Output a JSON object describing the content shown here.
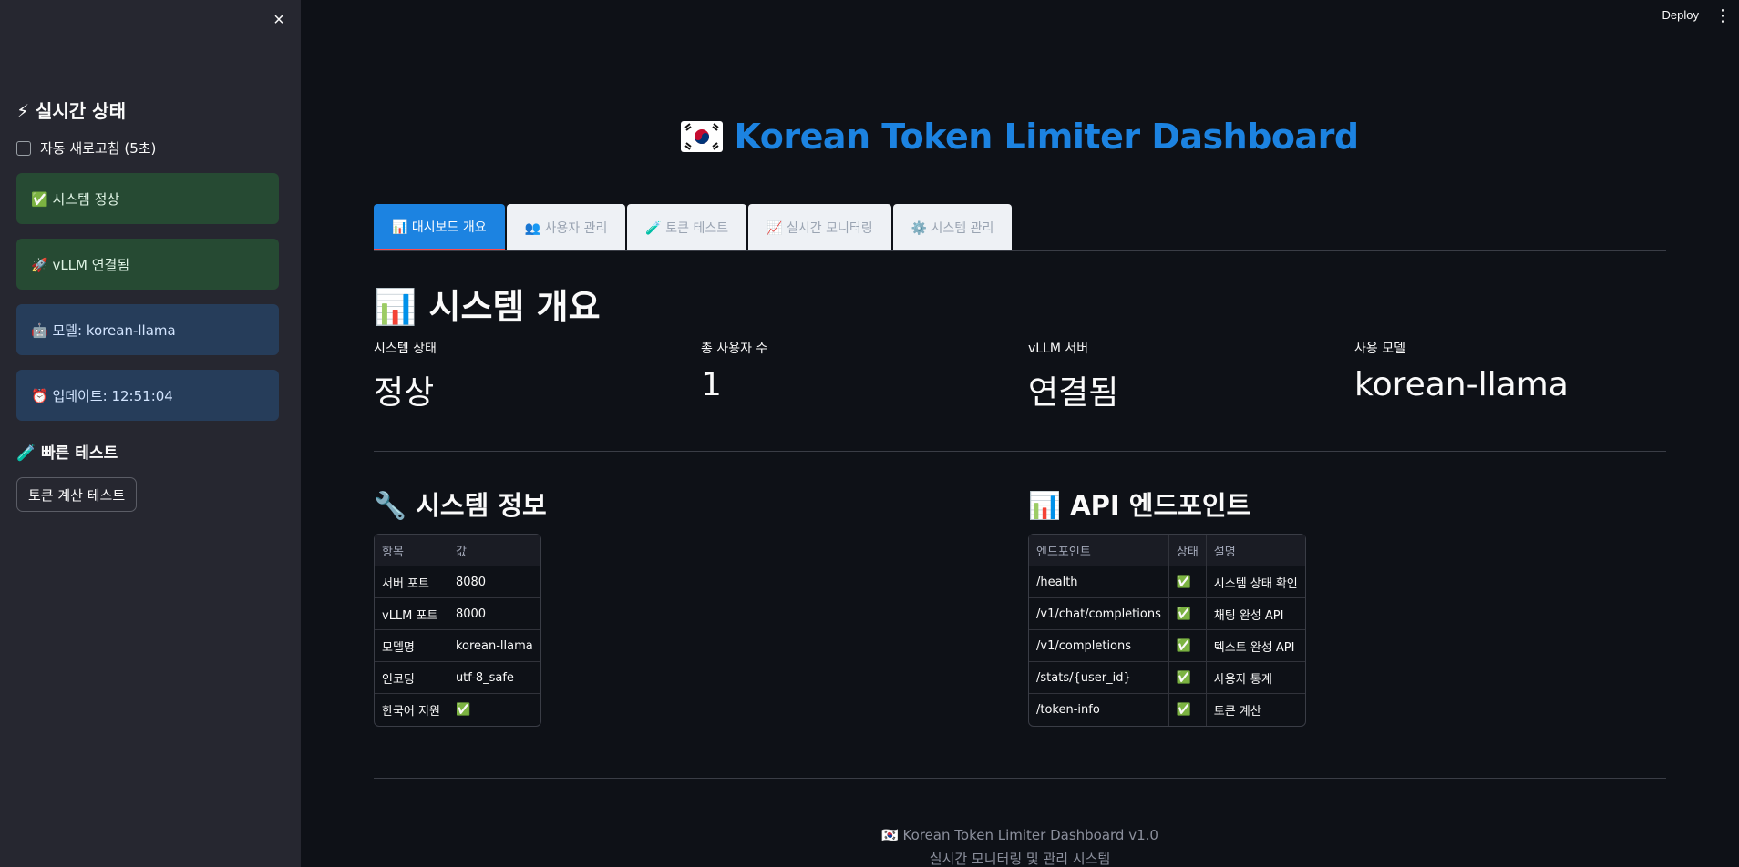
{
  "sidebar": {
    "close_label": "×",
    "realtime_title": "⚡ 실시간 상태",
    "auto_refresh_label": "자동 새로고침 (5초)",
    "auto_refresh_checked": false,
    "cards": [
      {
        "text": "✅ 시스템 정상",
        "kind": "success"
      },
      {
        "text": "🚀 vLLM 연결됨",
        "kind": "success"
      },
      {
        "text": "🤖 모델: korean-llama",
        "kind": "info"
      },
      {
        "text": "⏰ 업데이트: 12:51:04",
        "kind": "info"
      }
    ],
    "quick_test_title": "🧪 빠른 테스트",
    "quick_test_button": "토큰 계산 테스트"
  },
  "topbar": {
    "deploy_label": "Deploy",
    "menu_icon": "kebab-menu-icon"
  },
  "header": {
    "title": "Korean Token Limiter Dashboard",
    "flag_icon": "korean-flag-icon"
  },
  "tabs": [
    {
      "label": "📊 대시보드 개요",
      "active": true
    },
    {
      "label": "👥 사용자 관리",
      "active": false
    },
    {
      "label": "🧪 토큰 테스트",
      "active": false
    },
    {
      "label": "📈 실시간 모니터링",
      "active": false
    },
    {
      "label": "⚙️ 시스템 관리",
      "active": false
    }
  ],
  "overview": {
    "title": "📊 시스템 개요",
    "metrics": [
      {
        "label": "시스템 상태",
        "value": "정상"
      },
      {
        "label": "총 사용자 수",
        "value": "1"
      },
      {
        "label": "vLLM 서버",
        "value": "연결됨"
      },
      {
        "label": "사용 모델",
        "value": "korean-llama"
      }
    ]
  },
  "system_info": {
    "title": "🔧 시스템 정보",
    "columns": [
      "항목",
      "값"
    ],
    "rows": [
      [
        "서버 포트",
        "8080"
      ],
      [
        "vLLM 포트",
        "8000"
      ],
      [
        "모델명",
        "korean-llama"
      ],
      [
        "인코딩",
        "utf-8_safe"
      ],
      [
        "한국어 지원",
        "✅"
      ]
    ]
  },
  "api": {
    "title": "📊 API 엔드포인트",
    "columns": [
      "엔드포인트",
      "상태",
      "설명"
    ],
    "rows": [
      [
        "/health",
        "✅",
        "시스템 상태 확인"
      ],
      [
        "/v1/chat/completions",
        "✅",
        "채팅 완성 API"
      ],
      [
        "/v1/completions",
        "✅",
        "텍스트 완성 API"
      ],
      [
        "/stats/{user_id}",
        "✅",
        "사용자 통계"
      ],
      [
        "/token-info",
        "✅",
        "토큰 계산"
      ]
    ]
  },
  "footer": {
    "line1": "🇰🇷 Korean Token Limiter Dashboard v1.0",
    "line2": "실시간 모니터링 및 관리 시스템"
  }
}
